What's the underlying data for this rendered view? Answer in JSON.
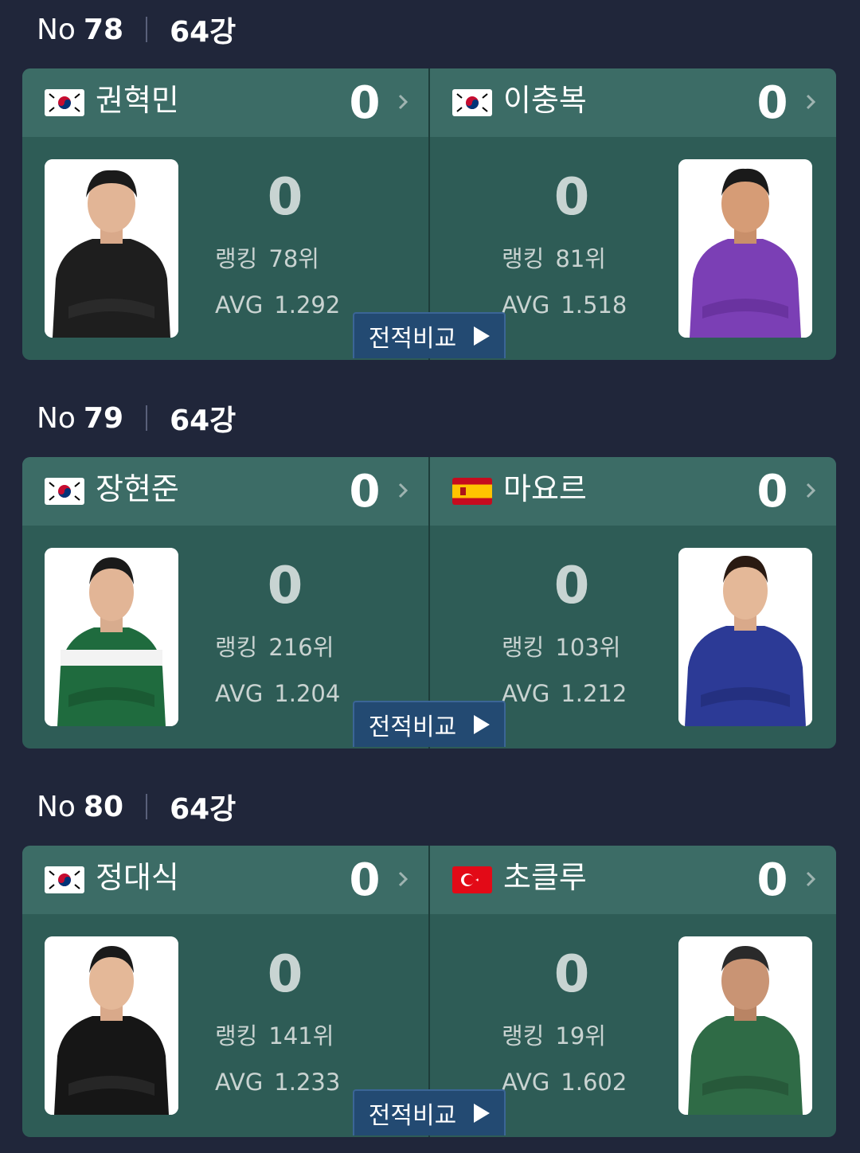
{
  "matches": [
    {
      "no_label": "No",
      "no": "78",
      "round": "64강",
      "compare_label": "전적비교",
      "left": {
        "name": "권혁민",
        "flag": "korea",
        "score": "0",
        "game_score": "0",
        "rank_label": "랭킹",
        "rank": "78위",
        "avg_label": "AVG",
        "avg": "1.292",
        "jersey": "black"
      },
      "right": {
        "name": "이충복",
        "flag": "korea",
        "score": "0",
        "game_score": "0",
        "rank_label": "랭킹",
        "rank": "81위",
        "avg_label": "AVG",
        "avg": "1.518",
        "jersey": "purple"
      }
    },
    {
      "no_label": "No",
      "no": "79",
      "round": "64강",
      "compare_label": "전적비교",
      "left": {
        "name": "장현준",
        "flag": "korea",
        "score": "0",
        "game_score": "0",
        "rank_label": "랭킹",
        "rank": "216위",
        "avg_label": "AVG",
        "avg": "1.204",
        "jersey": "green-white"
      },
      "right": {
        "name": "마요르",
        "flag": "spain",
        "score": "0",
        "game_score": "0",
        "rank_label": "랭킹",
        "rank": "103위",
        "avg_label": "AVG",
        "avg": "1.212",
        "jersey": "navy"
      }
    },
    {
      "no_label": "No",
      "no": "80",
      "round": "64강",
      "compare_label": "전적비교",
      "left": {
        "name": "정대식",
        "flag": "korea",
        "score": "0",
        "game_score": "0",
        "rank_label": "랭킹",
        "rank": "141위",
        "avg_label": "AVG",
        "avg": "1.233",
        "jersey": "black"
      },
      "right": {
        "name": "초클루",
        "flag": "turkey",
        "score": "0",
        "game_score": "0",
        "rank_label": "랭킹",
        "rank": "19위",
        "avg_label": "AVG",
        "avg": "1.602",
        "jersey": "dark-green"
      }
    }
  ],
  "colors": {
    "background": "#20263a",
    "card": "#2e5c56",
    "card_header": "#3c6c66",
    "compare_button": "#234a72"
  },
  "icons": [
    "chevron-right-icon",
    "play-arrow-icon",
    "korea-flag-icon",
    "spain-flag-icon",
    "turkey-flag-icon"
  ]
}
